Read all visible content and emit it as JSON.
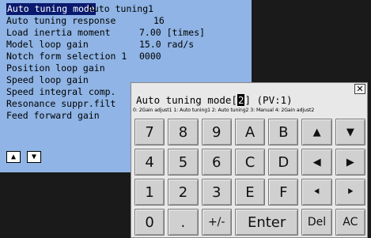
{
  "params": {
    "rows": [
      {
        "name": "Auto tuning mode",
        "value": "Auto tuning1"
      },
      {
        "name": "Auto tuning response",
        "value": "16"
      },
      {
        "name": "Load inertia moment",
        "value": "7.00 [times]"
      },
      {
        "name": "Model loop gain",
        "value": "15.0 rad/s"
      },
      {
        "name": "Notch form selection 1",
        "value": "0000"
      },
      {
        "name": "Position loop gain",
        "value": ""
      },
      {
        "name": "Speed loop gain",
        "value": ""
      },
      {
        "name": "Speed integral comp.",
        "value": ""
      },
      {
        "name": "Resonance suppr.filt",
        "value": ""
      },
      {
        "name": "Feed forward gain",
        "value": ""
      }
    ],
    "scroll_up": "▲",
    "scroll_down": "▼"
  },
  "keypad": {
    "close": "✕",
    "title_prefix": "Auto tuning mode[",
    "current_value": "2",
    "title_suffix": "] (PV:1)",
    "options_line": "0: 2Gain adjust1 1: Auto tuning1 2: Auto tuning2 3: Manual 4: 2Gain adjust2",
    "keys": [
      "7",
      "8",
      "9",
      "A",
      "B",
      "▲",
      "▼",
      "4",
      "5",
      "6",
      "C",
      "D",
      "◀",
      "▶",
      "1",
      "2",
      "3",
      "E",
      "F",
      "⯇",
      "⯈",
      "0",
      ".",
      "+/-",
      "Enter",
      "Del",
      "AC"
    ]
  }
}
